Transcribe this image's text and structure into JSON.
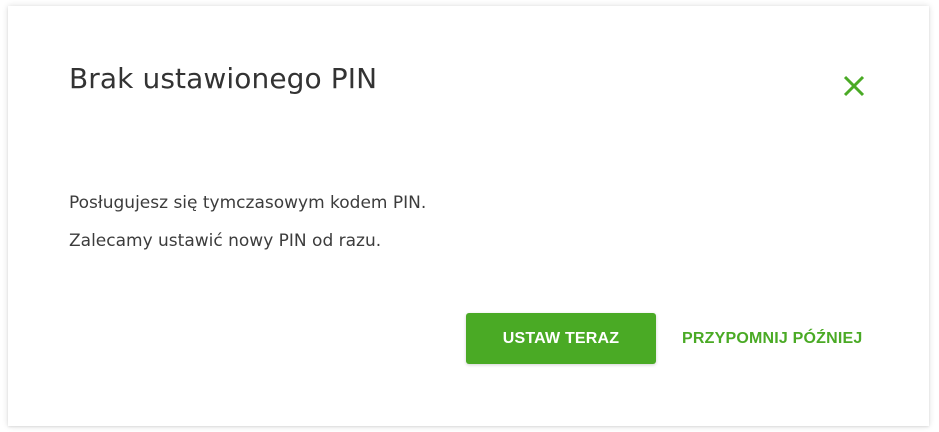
{
  "dialog": {
    "title": "Brak ustawionego PIN",
    "close_icon": "close-icon",
    "message_lines": [
      "Posługujesz się tymczasowym kodem PIN.",
      "Zalecamy ustawić nowy PIN od razu."
    ],
    "primary_button_label": "USTAW TERAZ",
    "secondary_button_label": "PRZYPOMNIJ PÓŹNIEJ"
  },
  "colors": {
    "accent": "#4aaa25",
    "text": "#333333",
    "background": "#ffffff"
  }
}
